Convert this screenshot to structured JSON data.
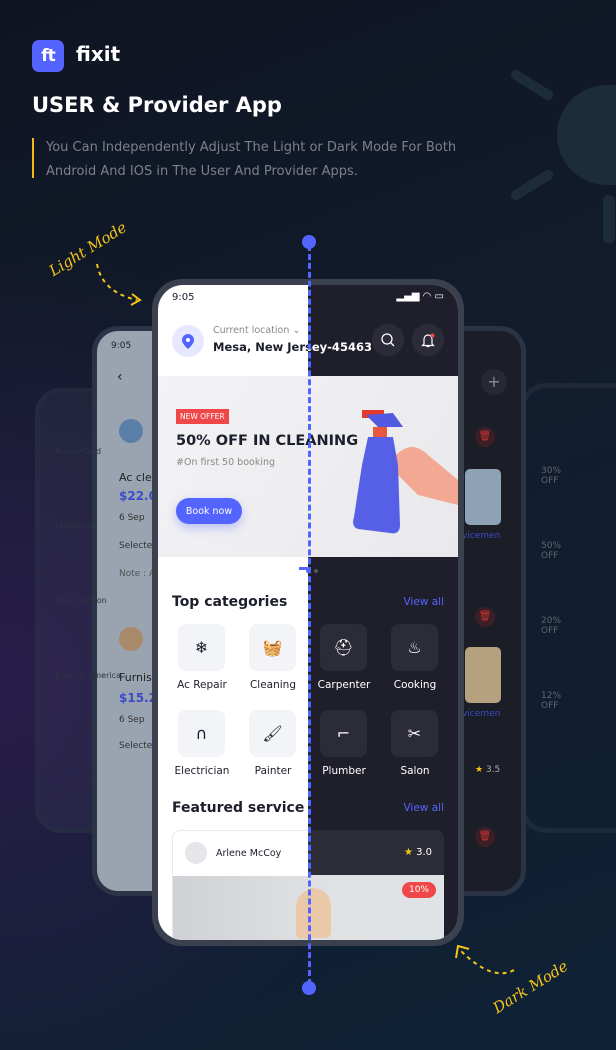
{
  "brand": {
    "logo_text": "ft",
    "name": "fixit"
  },
  "headline": "USER & Provider App",
  "description": "You Can Independently Adjust The Light or Dark Mode For Both Android And IOS in The User And Provider Apps.",
  "labels": {
    "light_mode": "Light Mode",
    "dark_mode": "Dark Mode"
  },
  "colors": {
    "accent": "#5465ff",
    "highlight": "#f5c518",
    "badge": "#f04848",
    "dark_bg": "#1e1f2b"
  },
  "phone": {
    "status_time": "9:05",
    "location_label": "Current location",
    "location_value": "Mesa, New Jersey-45463",
    "banner": {
      "badge": "NEW OFFER",
      "title": "50% OFF IN CLEANING",
      "subtitle": "#On first 50 booking",
      "button": "Book now"
    },
    "categories_title": "Top categories",
    "view_all": "View all",
    "categories": [
      {
        "label": "Ac Repair",
        "icon": "air-conditioner-icon"
      },
      {
        "label": "Cleaning",
        "icon": "cleaning-bucket-icon"
      },
      {
        "label": "Carpenter",
        "icon": "worker-helmet-icon"
      },
      {
        "label": "Cooking",
        "icon": "grill-icon"
      },
      {
        "label": "Electrician",
        "icon": "magnet-icon"
      },
      {
        "label": "Painter",
        "icon": "paint-roller-icon"
      },
      {
        "label": "Plumber",
        "icon": "pipe-icon"
      },
      {
        "label": "Salon",
        "icon": "eyebrow-icon"
      }
    ],
    "featured_title": "Featured service",
    "featured": {
      "provider": "Arlene McCoy",
      "rating": "3.0",
      "discount": "10%"
    }
  },
  "back_left": {
    "time": "9:05",
    "items": [
      {
        "title": "Ac clea",
        "price": "$22.00",
        "date": "6 Sep",
        "selected": "Selected",
        "note": "Note : As"
      },
      {
        "title": "Furnish",
        "price": "$15.23",
        "date": "6 Sep",
        "selected": "Selected"
      }
    ],
    "cards": [
      "MasterCard",
      "Facebook",
      "Louis Vuitton",
      "Bank of America"
    ]
  },
  "back_right": {
    "servicemen": "Servicemen",
    "rating": "3.5",
    "offers": [
      "30% OFF",
      "50% OFF",
      "20% OFF",
      "12% OFF"
    ]
  }
}
